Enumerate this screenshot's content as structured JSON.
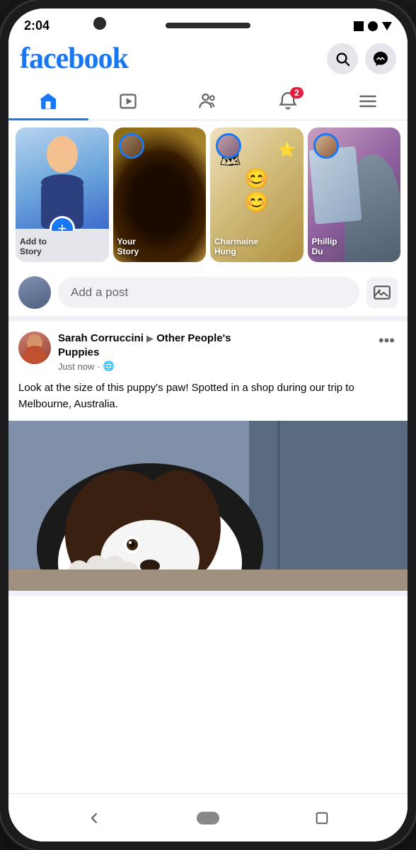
{
  "phone": {
    "status_bar": {
      "time": "2:04",
      "icons": [
        "square",
        "dot",
        "triangle"
      ]
    }
  },
  "header": {
    "logo": "facebook",
    "search_icon": "🔍",
    "messenger_icon": "💬"
  },
  "nav": {
    "tabs": [
      {
        "id": "home",
        "label": "Home",
        "active": true
      },
      {
        "id": "watch",
        "label": "Watch",
        "active": false
      },
      {
        "id": "groups",
        "label": "Groups",
        "active": false
      },
      {
        "id": "notifications",
        "label": "Notifications",
        "badge": "2",
        "active": false
      },
      {
        "id": "menu",
        "label": "Menu",
        "active": false
      }
    ]
  },
  "stories": {
    "cards": [
      {
        "id": "add-story",
        "line1": "Add to",
        "line2": "Story"
      },
      {
        "id": "your-story",
        "line1": "Your",
        "line2": "Story"
      },
      {
        "id": "charmaine",
        "line1": "Charmaine",
        "line2": "Hung"
      },
      {
        "id": "phillip",
        "line1": "Phillip",
        "line2": "Du"
      }
    ]
  },
  "composer": {
    "placeholder": "Add a post",
    "photo_icon": "🖼"
  },
  "post": {
    "author": "Sarah Corruccini",
    "arrow": "▶",
    "group": "Other People's Puppies",
    "timestamp": "Just now",
    "privacy": "🌐",
    "more": "•••",
    "text": "Look at the size of this puppy's paw! Spotted in a shop during our trip to Melbourne, Australia."
  },
  "bottom_nav": {
    "back": "◁",
    "home": "⬜",
    "recent": "□"
  }
}
